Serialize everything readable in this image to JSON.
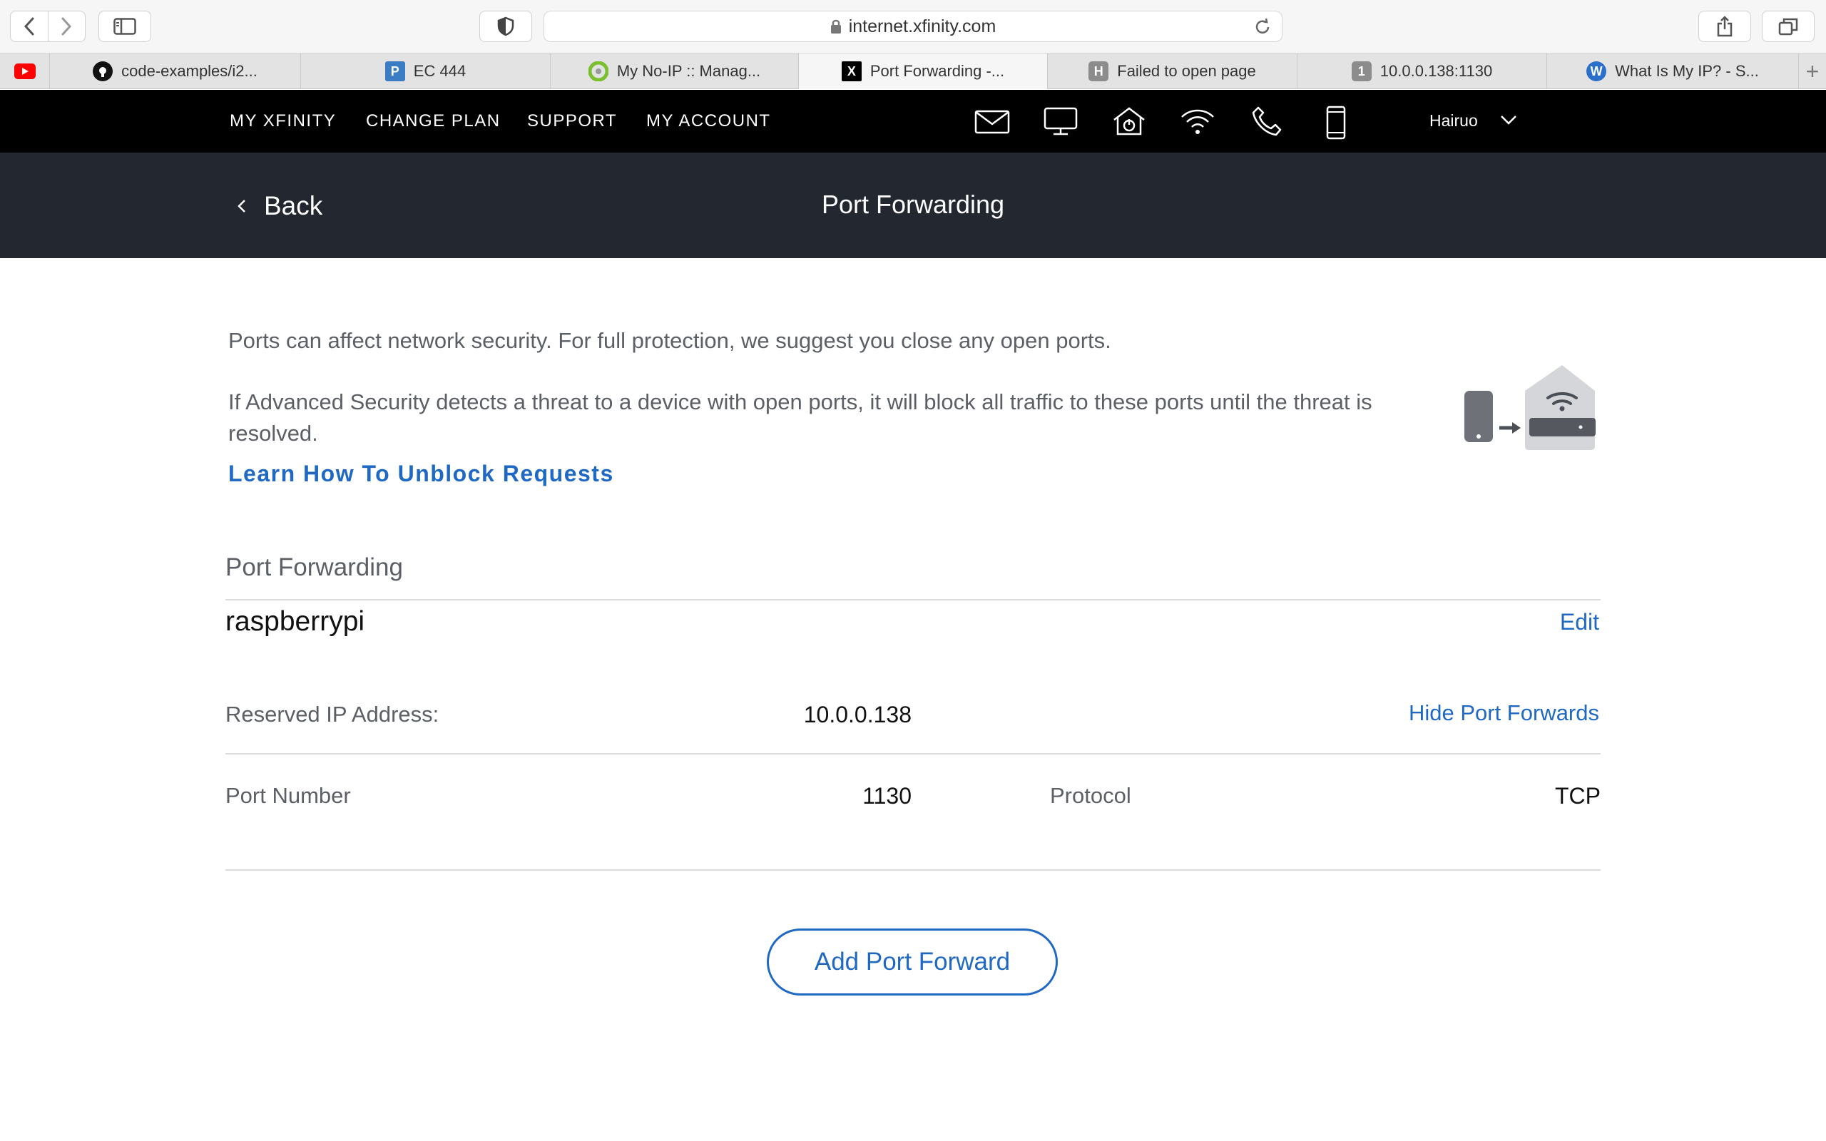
{
  "browser": {
    "url": "internet.xfinity.com",
    "tabs": [
      {
        "label": "",
        "icon": "youtube-icon",
        "color": "#ff0000"
      },
      {
        "label": "code-examples/i2...",
        "icon": "github-icon",
        "color": "#111111"
      },
      {
        "label": "EC 444",
        "icon": "piazza-icon",
        "color": "#3b7dc4"
      },
      {
        "label": "My No-IP :: Manag...",
        "icon": "noip-icon",
        "color": "#7bbf2f"
      },
      {
        "label": "Port Forwarding -...",
        "icon": "xfinity-icon",
        "color": "#000000",
        "active": true
      },
      {
        "label": "Failed to open page",
        "icon": "H",
        "color": "#8c8c8c"
      },
      {
        "label": "10.0.0.138:1130",
        "icon": "1",
        "color": "#8c8c8c"
      },
      {
        "label": "What Is My IP? - S...",
        "icon": "whatismyip-icon",
        "color": "#2a6fc9"
      }
    ]
  },
  "nav": {
    "links": [
      "MY XFINITY",
      "CHANGE PLAN",
      "SUPPORT",
      "MY ACCOUNT"
    ],
    "icons": [
      "mail-icon",
      "tv-icon",
      "home-security-icon",
      "wifi-icon",
      "phone-icon",
      "mobile-icon"
    ],
    "user": "Hairuo"
  },
  "header": {
    "back_label": "Back",
    "title": "Port Forwarding"
  },
  "content": {
    "para1": "Ports can affect network security. For full protection, we suggest you close any open ports.",
    "para2_line1": "If Advanced Security detects a threat to a device with open ports, it will block all traffic to these ports until the threat is",
    "para2_line2": "resolved.",
    "learn_link": "Learn How To Unblock Requests"
  },
  "port_forwarding": {
    "section_title": "Port Forwarding",
    "device_name": "raspberrypi",
    "edit_label": "Edit",
    "reserved_ip_label": "Reserved IP Address:",
    "reserved_ip": "10.0.0.138",
    "hide_label": "Hide Port Forwards",
    "port_label": "Port Number",
    "port_value": "1130",
    "protocol_label": "Protocol",
    "protocol_value": "TCP",
    "add_label": "Add Port Forward"
  },
  "colors": {
    "accent": "#1f69c4",
    "nav_bg": "#000000",
    "subheader_bg": "#23272f"
  }
}
